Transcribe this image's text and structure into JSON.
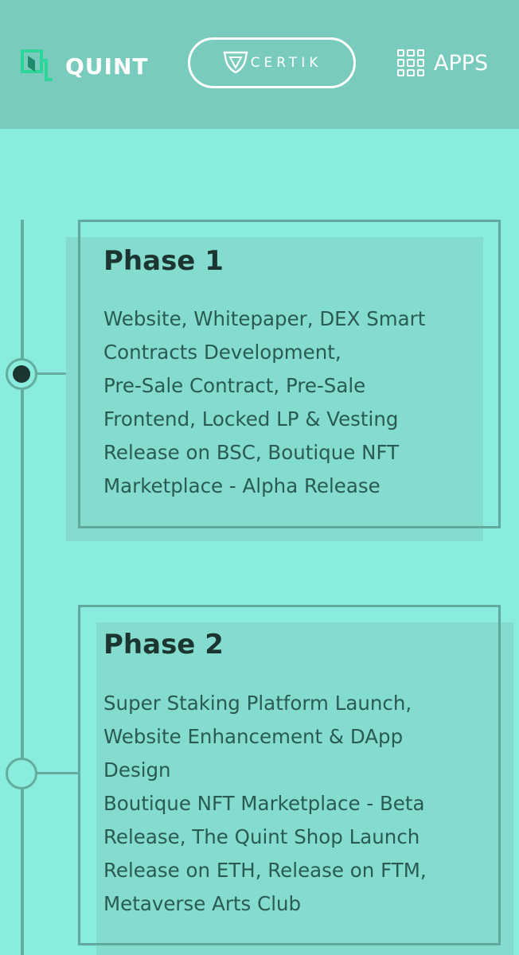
{
  "header": {
    "brand": "QUINT",
    "badge_label": "CERTIK",
    "apps_label": "APPS",
    "icons": {
      "brand": "quint-logo-icon",
      "badge": "certik-shield-icon",
      "apps": "apps-grid-icon"
    }
  },
  "colors": {
    "background": "#8aecdc",
    "header": "#79cbbd",
    "accent_line": "#63ad9f",
    "title_text": "#1d3530",
    "body_text": "#295b53",
    "logo_green": "#3ad9a4"
  },
  "roadmap": {
    "phases": [
      {
        "title": "Phase 1",
        "lines": [
          "Website, Whitepaper, DEX Smart",
          "Contracts Development,",
          "Pre-Sale Contract, Pre-Sale",
          "Frontend, Locked LP & Vesting",
          "Release on BSC, Boutique NFT",
          "Marketplace - Alpha Release"
        ],
        "status": "active"
      },
      {
        "title": "Phase 2",
        "lines": [
          "Super Staking Platform Launch,",
          "Website Enhancement & DApp",
          "Design",
          "Boutique NFT Marketplace - Beta",
          "Release, The Quint Shop Launch",
          "Release on ETH, Release on FTM,",
          "Metaverse Arts Club"
        ],
        "status": "upcoming"
      }
    ]
  }
}
